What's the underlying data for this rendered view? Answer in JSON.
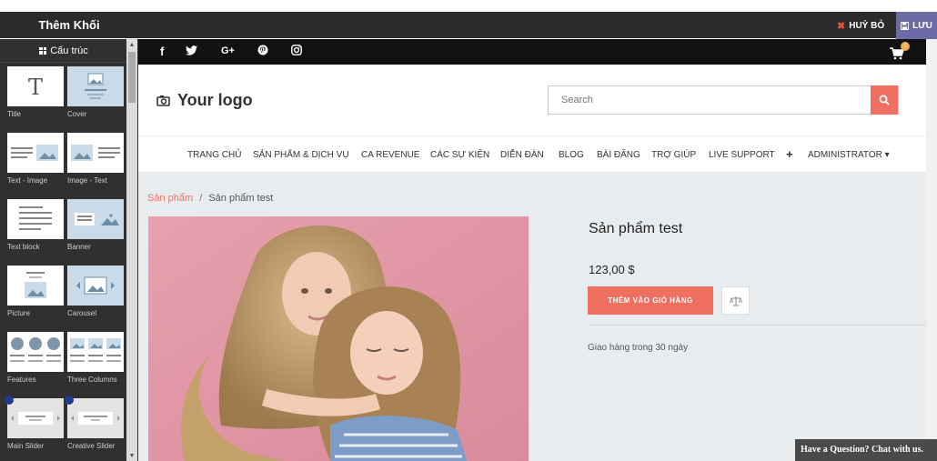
{
  "app": {
    "panel_title": "Thêm Khối",
    "discard_label": "HUỶ BỎ",
    "save_label": "LƯU"
  },
  "sidebar": {
    "header_label": "Cấu trúc",
    "tiles": [
      {
        "label": "Title",
        "icon": "title-T-icon"
      },
      {
        "label": "Cover",
        "icon": "cover-icon"
      },
      {
        "label": "Text - Image",
        "icon": "text-image-icon"
      },
      {
        "label": "Image - Text",
        "icon": "image-text-icon"
      },
      {
        "label": "Text block",
        "icon": "text-block-icon"
      },
      {
        "label": "Banner",
        "icon": "banner-icon"
      },
      {
        "label": "Picture",
        "icon": "picture-icon"
      },
      {
        "label": "Carousel",
        "icon": "carousel-icon"
      },
      {
        "label": "Features",
        "icon": "features-icon"
      },
      {
        "label": "Three Columns",
        "icon": "three-columns-icon"
      },
      {
        "label": "Main Slider",
        "icon": "main-slider-icon"
      },
      {
        "label": "Creative Slider",
        "icon": "creative-slider-icon"
      }
    ]
  },
  "social": {
    "icons": [
      "facebook-icon",
      "twitter-icon",
      "google-plus-icon",
      "pinterest-icon",
      "instagram-icon"
    ],
    "glyphs": [
      "f",
      "🐦",
      "G+",
      "℗",
      "◎"
    ],
    "cart_count": "1"
  },
  "header": {
    "logo_text": "Your logo",
    "search_placeholder": "Search"
  },
  "nav": {
    "items": [
      "TRANG CHỦ",
      "SẢN PHẨM & DỊCH VỤ",
      "CA REVENUE",
      "CÁC SỰ KIỆN",
      "DIỄN ĐÀN",
      "BLOG",
      "BÀI ĐĂNG",
      "TRỢ GIÚP",
      "LIVE SUPPORT",
      "+",
      "ADMINISTRATOR ▾"
    ]
  },
  "breadcrumb": {
    "parent": "Sản phẩm",
    "separator": "/",
    "current": "Sản phẩm test"
  },
  "product": {
    "title": "Sản phẩm test",
    "price": "123,00 $",
    "add_to_cart": "THÊM VÀO GIỎ HÀNG",
    "shipping": "Giao hàng trong 30 ngày"
  },
  "chat": {
    "label": "Have a Question? Chat with us."
  },
  "colors": {
    "accent": "#ef6f60",
    "topbar": "#2b2b2b",
    "sidebar": "#303030",
    "save": "#6b6ba8",
    "thumb_light_blue": "#c9dbe8",
    "photo_bg": "#e8a2ae"
  }
}
